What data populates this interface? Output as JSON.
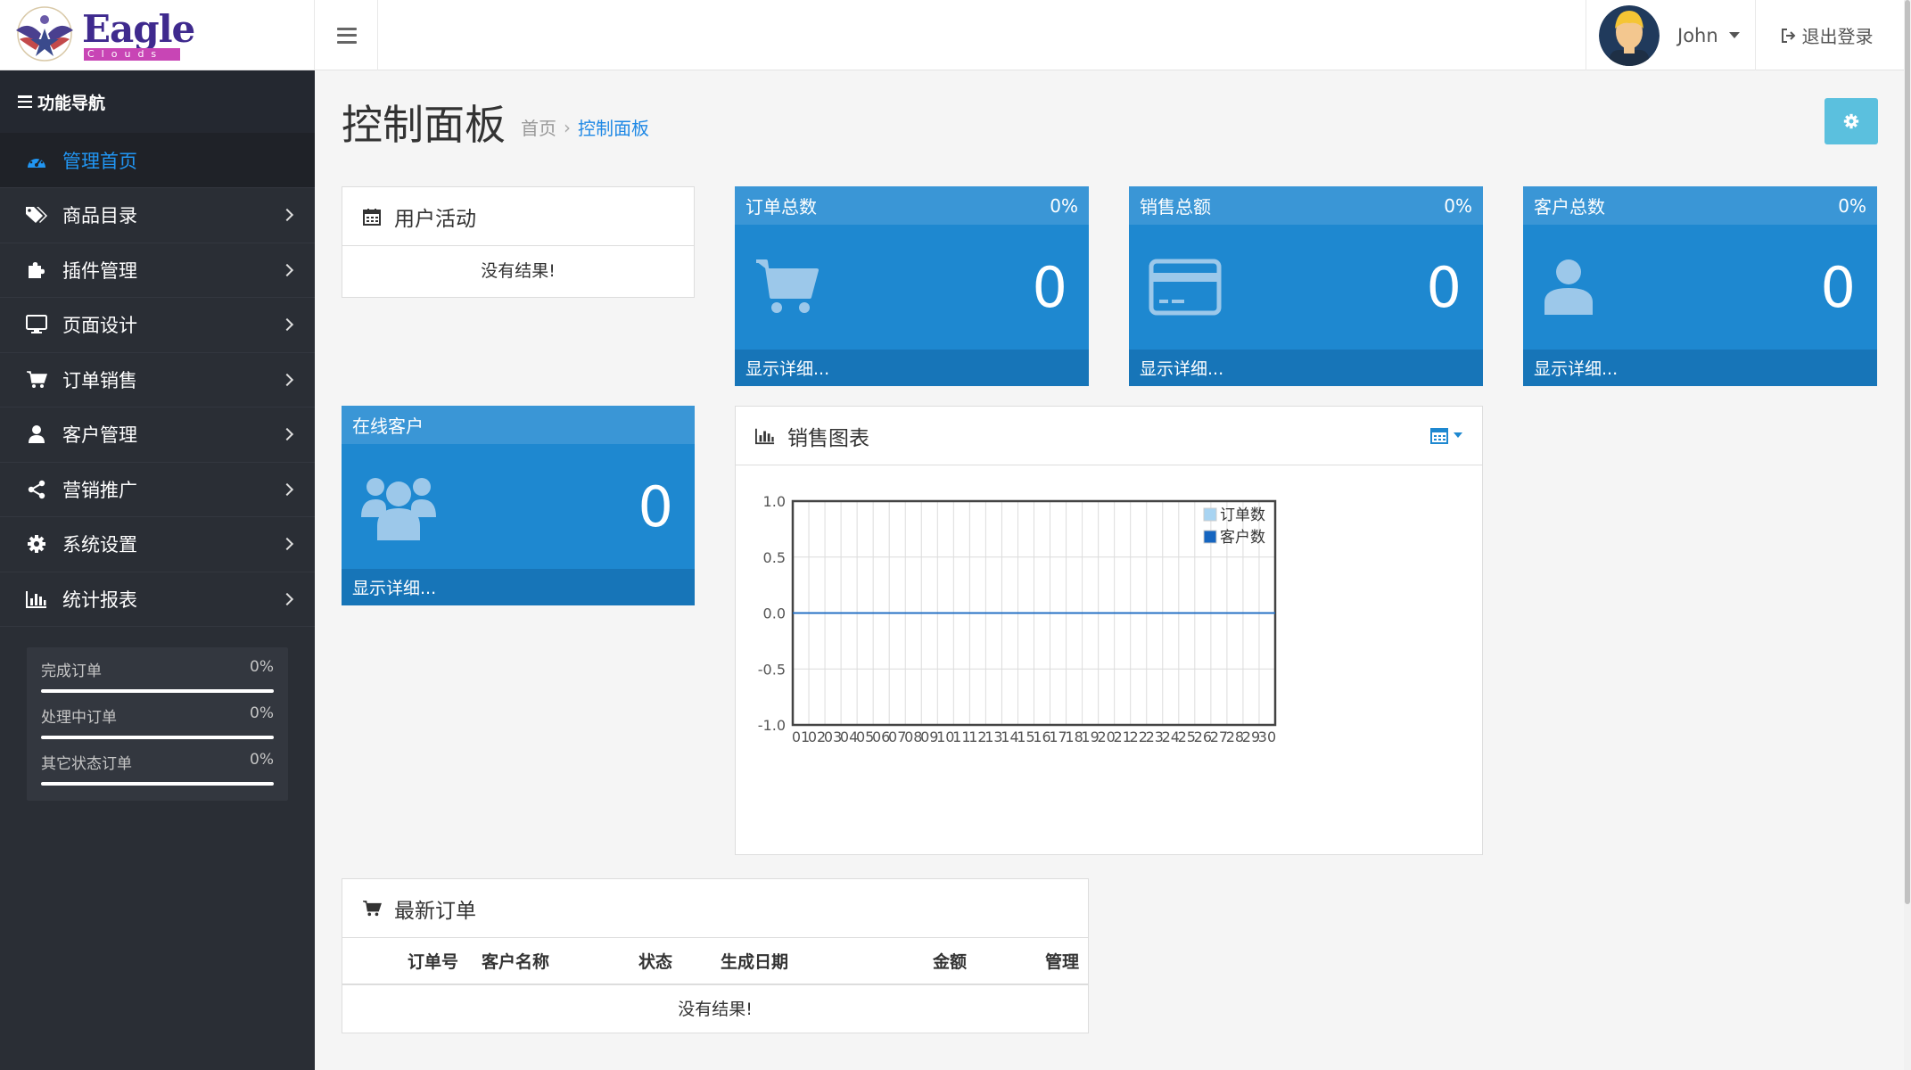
{
  "header": {
    "logo_title": "Eagle",
    "logo_subtitle": "Clouds",
    "user_name": "John",
    "logout_label": "退出登录"
  },
  "sidebar": {
    "heading": "功能导航",
    "items": [
      {
        "label": "管理首页",
        "icon": "dashboard-icon",
        "active": true
      },
      {
        "label": "商品目录",
        "icon": "tags-icon"
      },
      {
        "label": "插件管理",
        "icon": "puzzle-icon"
      },
      {
        "label": "页面设计",
        "icon": "monitor-icon"
      },
      {
        "label": "订单销售",
        "icon": "cart-icon"
      },
      {
        "label": "客户管理",
        "icon": "user-icon"
      },
      {
        "label": "营销推广",
        "icon": "share-icon"
      },
      {
        "label": "系统设置",
        "icon": "gear-icon"
      },
      {
        "label": "统计报表",
        "icon": "bar-chart-icon"
      }
    ],
    "progress": [
      {
        "label": "完成订单",
        "value": "0%",
        "fraction": 1.0
      },
      {
        "label": "处理中订单",
        "value": "0%",
        "fraction": 1.0
      },
      {
        "label": "其它状态订单",
        "value": "0%",
        "fraction": 1.0
      }
    ]
  },
  "page": {
    "title": "控制面板",
    "breadcrumb_home": "首页",
    "breadcrumb_sep": "›",
    "breadcrumb_current": "控制面板"
  },
  "activity": {
    "title": "用户活动",
    "empty": "没有结果!"
  },
  "stats": [
    {
      "title": "订单总数",
      "percent": "0%",
      "value": "0",
      "footer": "显示详细...",
      "icon": "cart-icon"
    },
    {
      "title": "销售总额",
      "percent": "0%",
      "value": "0",
      "footer": "显示详细...",
      "icon": "credit-card-icon"
    },
    {
      "title": "客户总数",
      "percent": "0%",
      "value": "0",
      "footer": "显示详细...",
      "icon": "user-icon"
    },
    {
      "title": "在线客户",
      "value": "0",
      "footer": "显示详细...",
      "icon": "users-icon"
    }
  ],
  "sales_chart": {
    "title": "销售图表"
  },
  "chart_data": {
    "type": "line",
    "x": [
      "01",
      "02",
      "03",
      "04",
      "05",
      "06",
      "07",
      "08",
      "09",
      "10",
      "11",
      "12",
      "13",
      "14",
      "15",
      "16",
      "17",
      "18",
      "19",
      "20",
      "21",
      "22",
      "23",
      "24",
      "25",
      "26",
      "27",
      "28",
      "29",
      "30"
    ],
    "ylim": [
      -1.0,
      1.0
    ],
    "yticks": [
      "1.0",
      "0.5",
      "0.0",
      "-0.5",
      "-1.0"
    ],
    "ytick_values": [
      1.0,
      0.5,
      0.0,
      -0.5,
      -1.0
    ],
    "grid": true,
    "legend_position": "top-right",
    "series": [
      {
        "name": "订单数",
        "color": "#a8d4f2",
        "values": [
          0,
          0,
          0,
          0,
          0,
          0,
          0,
          0,
          0,
          0,
          0,
          0,
          0,
          0,
          0,
          0,
          0,
          0,
          0,
          0,
          0,
          0,
          0,
          0,
          0,
          0,
          0,
          0,
          0,
          0
        ]
      },
      {
        "name": "客户数",
        "color": "#1565c0",
        "values": [
          0,
          0,
          0,
          0,
          0,
          0,
          0,
          0,
          0,
          0,
          0,
          0,
          0,
          0,
          0,
          0,
          0,
          0,
          0,
          0,
          0,
          0,
          0,
          0,
          0,
          0,
          0,
          0,
          0,
          0
        ]
      }
    ]
  },
  "orders": {
    "title": "最新订单",
    "columns": [
      "订单号",
      "客户名称",
      "状态",
      "生成日期",
      "金额",
      "管理"
    ],
    "empty": "没有结果!"
  },
  "colors": {
    "sidebar_bg": "#2a2e35",
    "accent": "#1e88d0",
    "active_link": "#2196f3",
    "gear_button": "#5bc0de"
  }
}
